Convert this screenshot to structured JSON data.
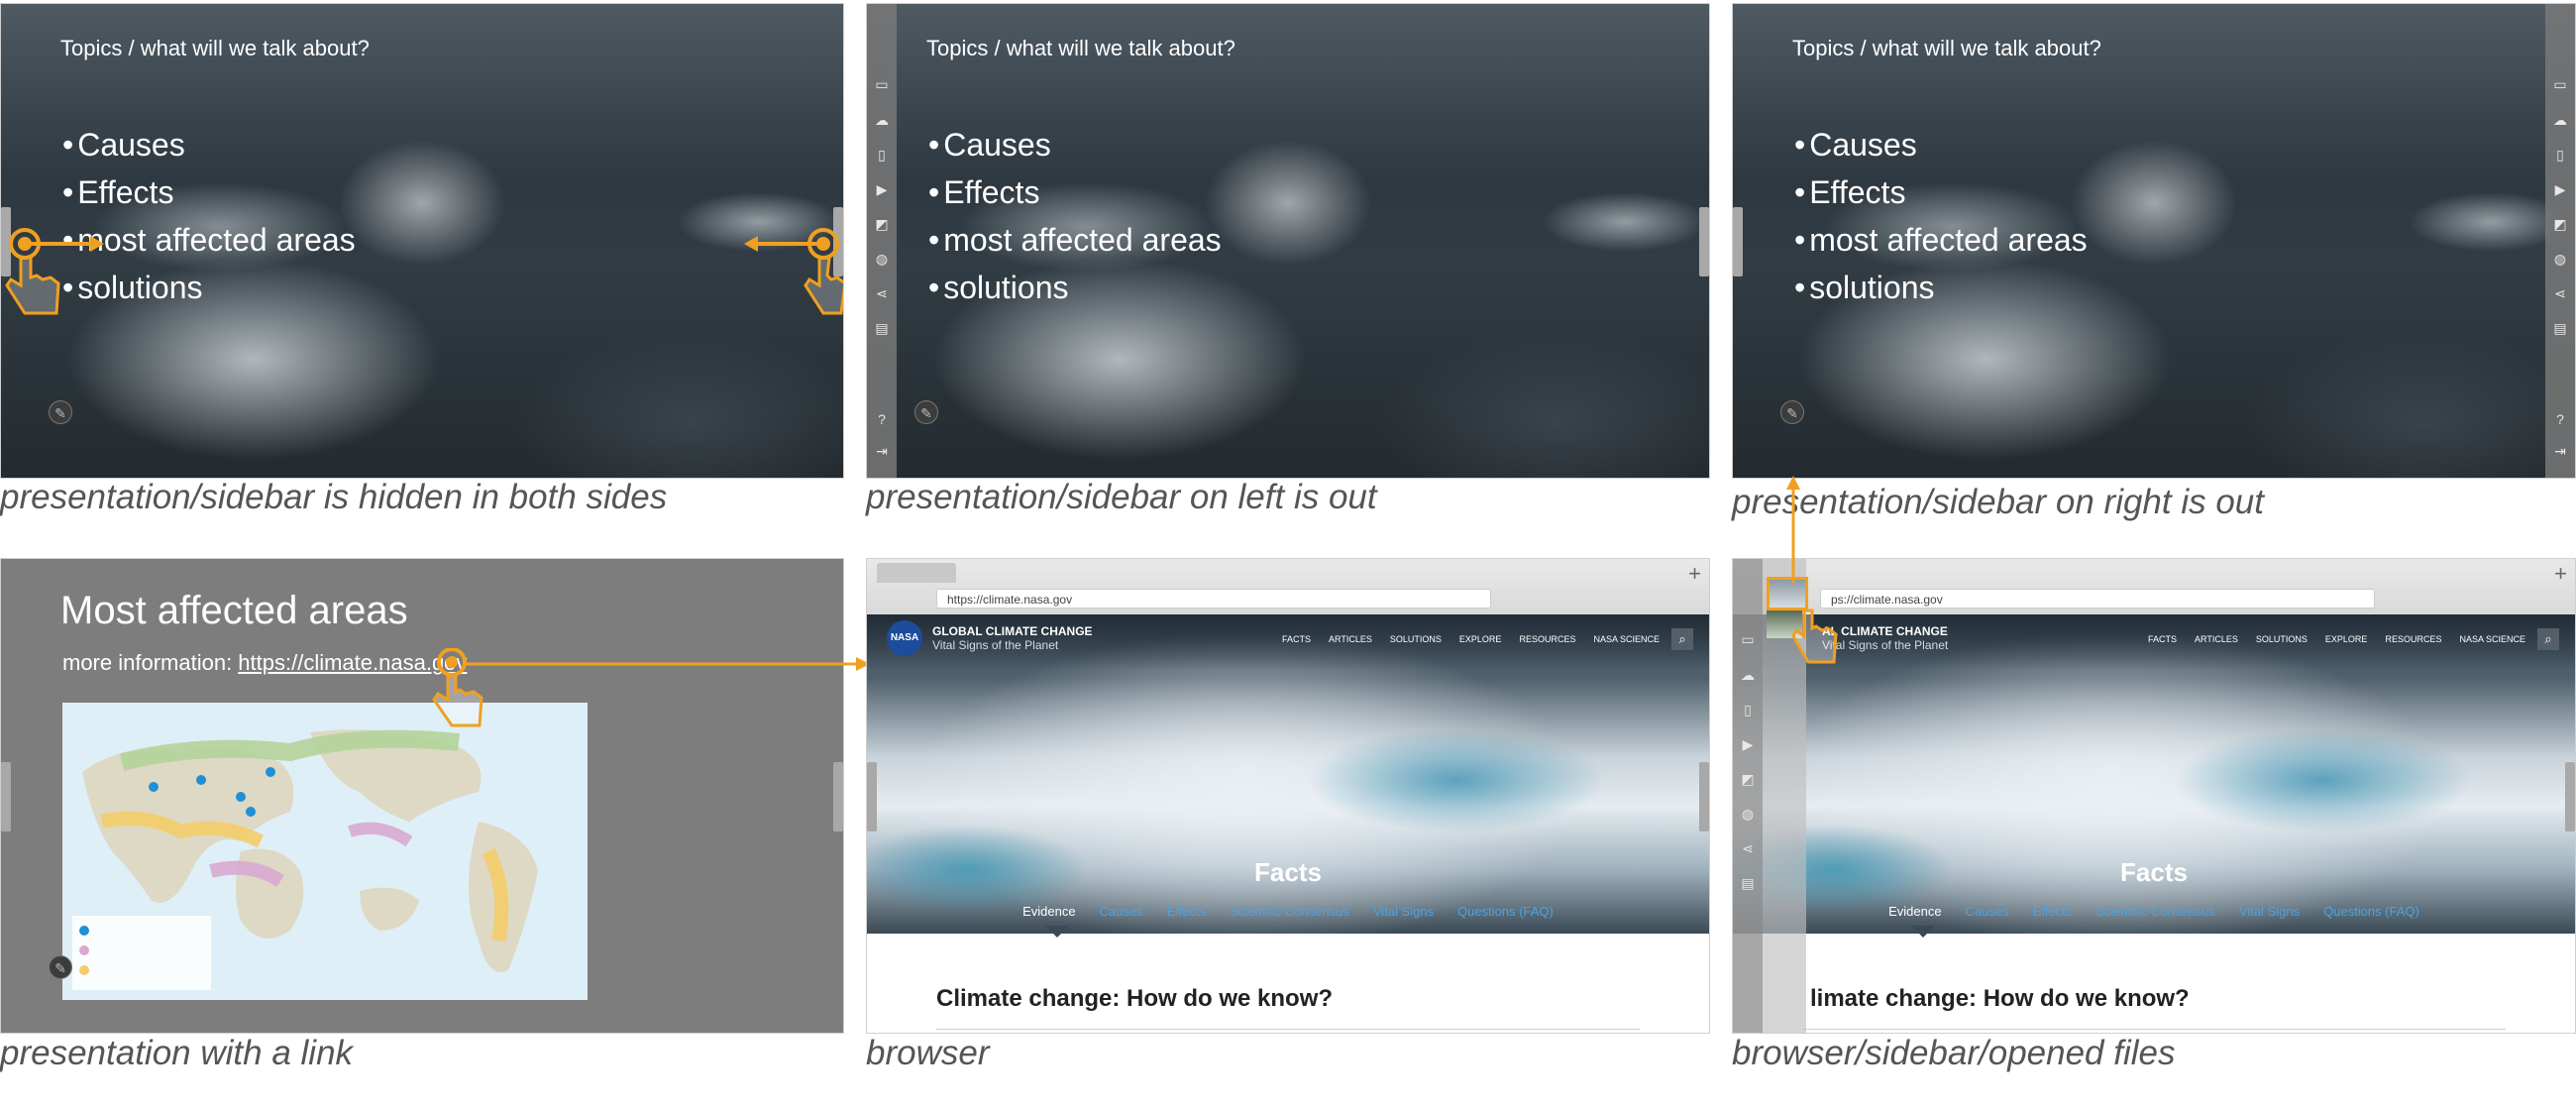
{
  "panels": [
    {
      "id": "p1",
      "title": "Topics / what will we talk about?",
      "bullets": [
        "Causes",
        "Effects",
        "most affected areas",
        "solutions"
      ],
      "caption": "presentation/sidebar is hidden in both sides"
    },
    {
      "id": "p2",
      "title": "Topics / what will we talk about?",
      "bullets": [
        "Causes",
        "Effects",
        "most affected areas",
        "solutions"
      ],
      "caption": "presentation/sidebar on left is out"
    },
    {
      "id": "p3",
      "title": "Topics / what will we talk about?",
      "bullets": [
        "Causes",
        "Effects",
        "most affected areas",
        "solutions"
      ],
      "caption": "presentation/sidebar on right is out"
    },
    {
      "id": "p4",
      "heading": "Most affected areas",
      "link_prefix": "more information: ",
      "link": "https://climate.nasa.gov",
      "caption": "presentation with a link"
    },
    {
      "id": "p5",
      "caption": "browser"
    },
    {
      "id": "p6",
      "caption": "browser/sidebar/opened files"
    }
  ],
  "sidebar_icons": [
    "cast-icon",
    "cloud-icon",
    "document-icon",
    "video-icon",
    "whiteboard-icon",
    "globe-icon",
    "share-icon",
    "files-icon",
    "help-icon",
    "exit-icon"
  ],
  "browser": {
    "url": "https://climate.nasa.gov",
    "url_partial": "ps://climate.nasa.gov",
    "logo": "NASA",
    "site_title": "GLOBAL CLIMATE CHANGE",
    "site_title_partial": "AL CLIMATE CHANGE",
    "site_subtitle": "Vital Signs of the Planet",
    "nav": [
      "FACTS",
      "ARTICLES",
      "SOLUTIONS",
      "EXPLORE",
      "RESOURCES",
      "NASA SCIENCE"
    ],
    "hero_label": "Facts",
    "subnav": [
      "Evidence",
      "Causes",
      "Effects",
      "Scientific Consensus",
      "Vital Signs",
      "Questions (FAQ)"
    ],
    "page_heading": "Climate change: How do we know?",
    "page_heading_partial": "limate change: How do we know?"
  },
  "colors": {
    "accent": "#f0a020",
    "link": "#4aa3e6",
    "slide_gray": "#7d7d7d"
  }
}
